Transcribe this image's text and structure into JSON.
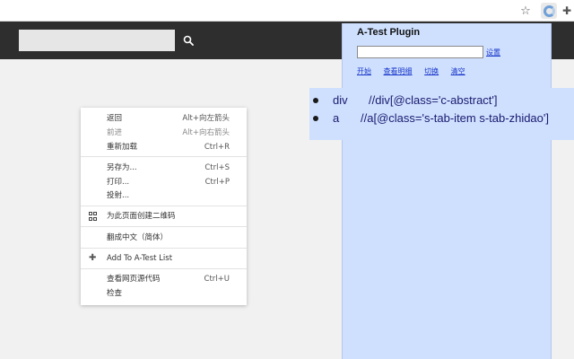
{
  "browser": {
    "icons": [
      "star-icon",
      "extension-icon",
      "puzzle-icon"
    ]
  },
  "context_menu": {
    "items": [
      {
        "label": "返回",
        "shortcut": "Alt+向左箭头",
        "disabled": false
      },
      {
        "label": "前进",
        "shortcut": "Alt+向右箭头",
        "disabled": true
      },
      {
        "label": "重新加载",
        "shortcut": "Ctrl+R",
        "disabled": false
      },
      {
        "label": "另存为...",
        "shortcut": "Ctrl+S",
        "disabled": false
      },
      {
        "label": "打印...",
        "shortcut": "Ctrl+P",
        "disabled": false
      },
      {
        "label": "投射...",
        "shortcut": "",
        "disabled": false
      },
      {
        "label": "为此页面创建二维码",
        "shortcut": "",
        "disabled": false,
        "icon": "qr-code-icon"
      },
      {
        "label": "翻成中文（简体）",
        "shortcut": "",
        "disabled": false
      },
      {
        "label": "Add To A-Test List",
        "shortcut": "",
        "disabled": false,
        "icon": "puzzle-icon"
      },
      {
        "label": "查看网页源代码",
        "shortcut": "Ctrl+U",
        "disabled": false
      },
      {
        "label": "检查",
        "shortcut": "",
        "disabled": false
      }
    ]
  },
  "popup": {
    "title": "A-Test Plugin",
    "input_value": "",
    "set_label": "设置",
    "links": [
      "开始",
      "查看明细",
      "切换",
      "清空"
    ]
  },
  "results": [
    {
      "tag": "div",
      "xpath": "//div[@class='c-abstract']"
    },
    {
      "tag": "a",
      "xpath": "//a[@class='s-tab-item s-tab-zhidao']"
    }
  ],
  "colors": {
    "header_bg": "#2e2e2e",
    "popup_bg": "#cfe0ff",
    "link": "#1a37c9"
  }
}
